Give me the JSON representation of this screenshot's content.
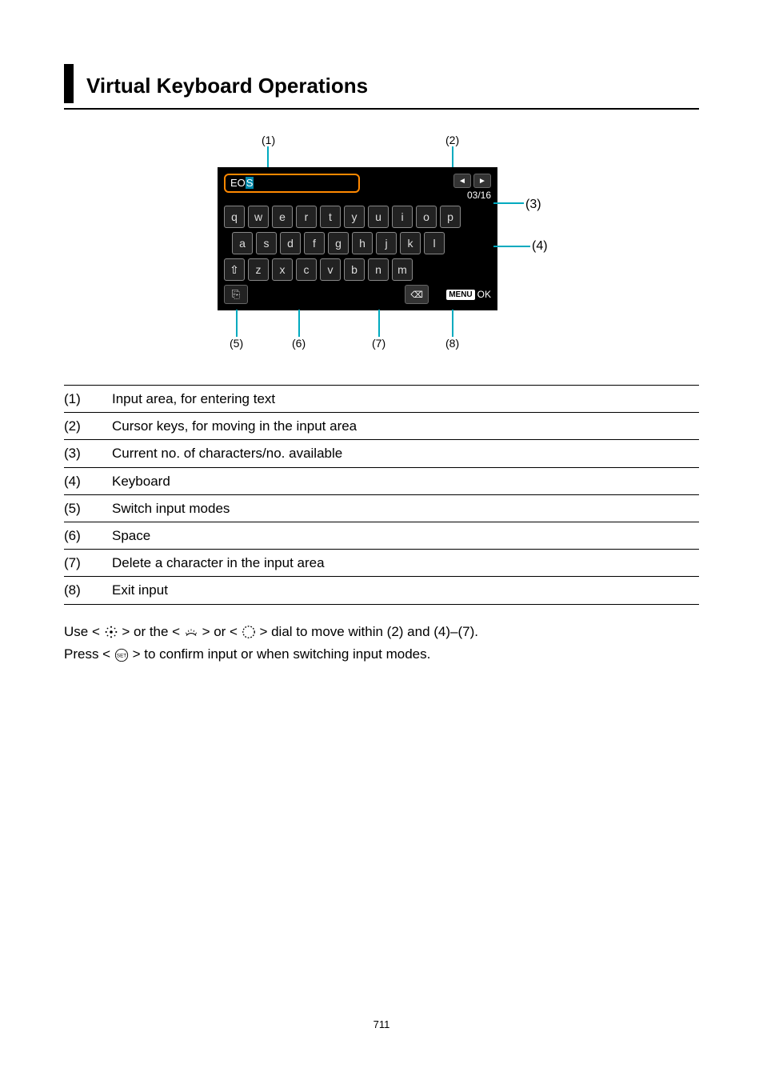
{
  "heading": "Virtual Keyboard Operations",
  "callouts": {
    "c1": "(1)",
    "c2": "(2)",
    "c3": "(3)",
    "c4": "(4)",
    "c5": "(5)",
    "c6": "(6)",
    "c7": "(7)",
    "c8": "(8)"
  },
  "keyboard": {
    "input_prefix": "EO",
    "input_cursor": "S",
    "arrow_left": "◄",
    "arrow_right": "►",
    "char_count": "03/16",
    "row1": [
      "q",
      "w",
      "e",
      "r",
      "t",
      "y",
      "u",
      "i",
      "o",
      "p"
    ],
    "row2": [
      "a",
      "s",
      "d",
      "f",
      "g",
      "h",
      "j",
      "k",
      "l"
    ],
    "row3_shift": "⇧",
    "row3": [
      "z",
      "x",
      "c",
      "v",
      "b",
      "n",
      "m"
    ],
    "mode_icon": "⎘",
    "del_icon": "⌫",
    "menu_label": "MENU",
    "ok_label": "OK"
  },
  "legend": [
    {
      "num": "(1)",
      "text": "Input area, for entering text"
    },
    {
      "num": "(2)",
      "text": "Cursor keys, for moving in the input area"
    },
    {
      "num": "(3)",
      "text": "Current no. of characters/no. available"
    },
    {
      "num": "(4)",
      "text": "Keyboard"
    },
    {
      "num": "(5)",
      "text": "Switch input modes"
    },
    {
      "num": "(6)",
      "text": "Space"
    },
    {
      "num": "(7)",
      "text": "Delete a character in the input area"
    },
    {
      "num": "(8)",
      "text": "Exit input"
    }
  ],
  "instructions": {
    "line1_a": "Use < ",
    "line1_b": " > or the < ",
    "line1_c": " > or < ",
    "line1_d": " > dial to move within (2) and (4)–(7).",
    "line2_a": "Press < ",
    "line2_b": " > to confirm input or when switching input modes."
  },
  "page_number": "711"
}
